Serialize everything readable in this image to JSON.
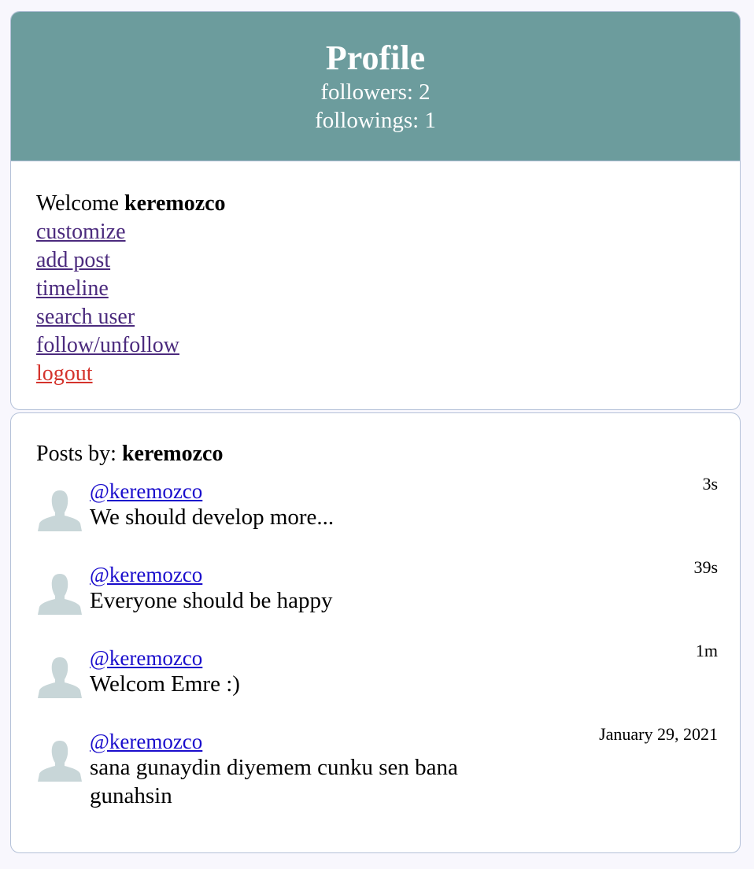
{
  "header": {
    "title": "Profile",
    "followers": "followers: 2",
    "followings": "followings: 1"
  },
  "menu": {
    "welcome_prefix": "Welcome ",
    "username": "keremozco",
    "links": {
      "customize": "customize",
      "add_post": "add post",
      "timeline": "timeline",
      "search_user": "search user",
      "follow_unfollow": "follow/unfollow",
      "logout": "logout"
    }
  },
  "posts": {
    "heading_prefix": "Posts by: ",
    "heading_user": "keremozco",
    "items": [
      {
        "user": "@keremozco",
        "text": "We should develop more...",
        "time": "3s",
        "avatar_icon": "user-avatar-icon"
      },
      {
        "user": "@keremozco",
        "text": "Everyone should be happy",
        "time": "39s",
        "avatar_icon": "user-avatar-icon"
      },
      {
        "user": "@keremozco",
        "text": "Welcom Emre :)",
        "time": "1m",
        "avatar_icon": "user-avatar-icon"
      },
      {
        "user": "@keremozco",
        "text": "sana gunaydin diyemem cunku sen bana gunahsin",
        "time": "January 29, 2021",
        "avatar_icon": "user-avatar-icon"
      }
    ]
  },
  "colors": {
    "header_bg": "#6c9c9d",
    "visited_link": "#4b2a7d",
    "logout_link": "#d4332c",
    "user_link": "#1a0dcc",
    "card_border": "#b4c1d8",
    "page_bg": "#f8f7fd",
    "avatar": "#c8d6d8"
  }
}
